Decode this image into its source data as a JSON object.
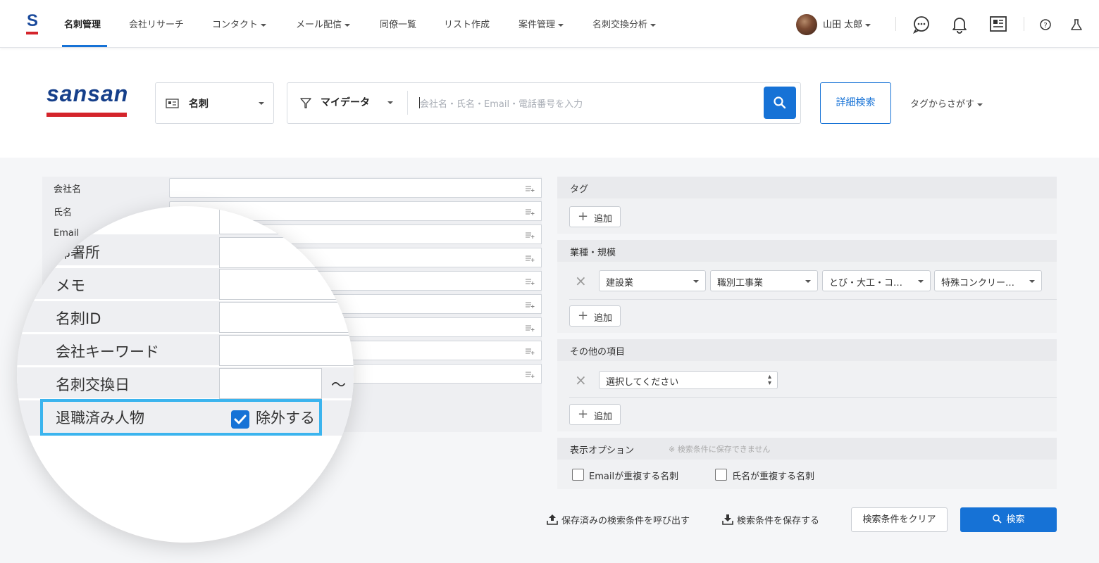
{
  "nav": {
    "logo_letter": "S",
    "items": [
      {
        "label": "名刺管理",
        "dropdown": false
      },
      {
        "label": "会社リサーチ",
        "dropdown": false
      },
      {
        "label": "コンタクト",
        "dropdown": true
      },
      {
        "label": "メール配信",
        "dropdown": true
      },
      {
        "label": "同僚一覧",
        "dropdown": false
      },
      {
        "label": "リスト作成",
        "dropdown": false
      },
      {
        "label": "案件管理",
        "dropdown": true
      },
      {
        "label": "名刺交換分析",
        "dropdown": true
      }
    ],
    "user_name": "山田 太郎"
  },
  "header": {
    "logo_text": "sansan",
    "type_selector": "名刺",
    "filter_selector": "マイデータ",
    "search_placeholder": "会社名・氏名・Email・電話番号を入力",
    "advanced_search": "詳細検索",
    "tag_search": "タグからさがす"
  },
  "form": {
    "fields": [
      "会社名",
      "氏名",
      "Email"
    ]
  },
  "magnifier": {
    "partial_label": "部署所",
    "labels": [
      "メモ",
      "名刺ID",
      "会社キーワード",
      "名刺交換日",
      "退職済み人物"
    ],
    "tilde": "〜",
    "retired_option": "除外する",
    "retired_checked": true
  },
  "right": {
    "tag_header": "タグ",
    "add_label": "追加",
    "industry_header": "業種・規模",
    "industry_selects": [
      "建設業",
      "職別工事業",
      "とび・大工・コ…",
      "特殊コンクリー…"
    ],
    "other_header": "その他の項目",
    "other_select": "選択してください",
    "display_header": "表示オプション",
    "display_note": "※ 検索条件に保存できません",
    "opt_email": "Emailが重複する名刺",
    "opt_name": "氏名が重複する名刺"
  },
  "footer": {
    "load_saved": "保存済みの検索条件を呼び出す",
    "save": "検索条件を保存する",
    "clear": "検索条件をクリア",
    "search": "検索"
  },
  "colors": {
    "accent": "#1672d6",
    "brand_red": "#d4242b",
    "highlight": "#3bb4ee"
  }
}
